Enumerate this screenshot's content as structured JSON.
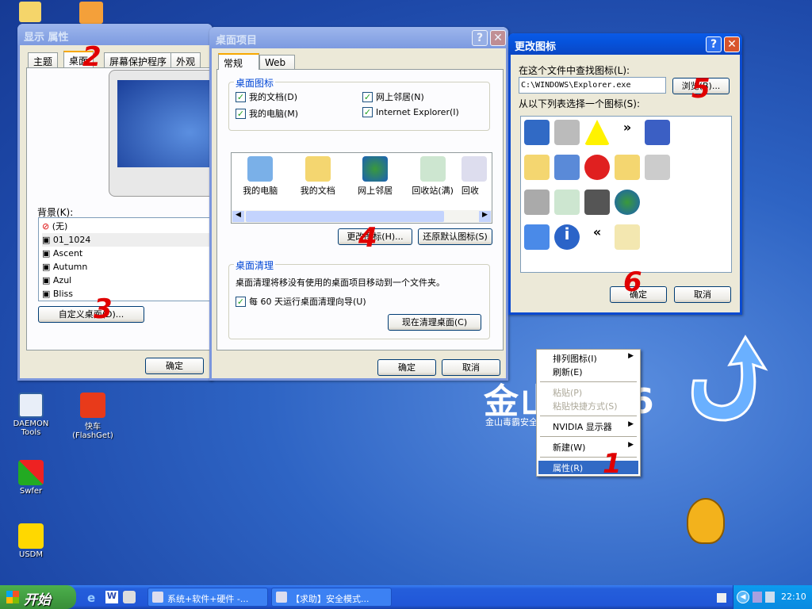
{
  "desktop": {
    "icons": [
      {
        "label": "DAEMON Tools"
      },
      {
        "label": "快车\n(FlashGet)"
      },
      {
        "label": "Swfer"
      },
      {
        "label": "USDM"
      }
    ],
    "logo_text": "金山毒霸6",
    "logo_sub": "金山毒霸安全 .net"
  },
  "display_props": {
    "title": "显示 属性",
    "tabs": [
      "主题",
      "桌面",
      "屏幕保护程序",
      "外观"
    ],
    "selected_tab": "桌面",
    "background_label": "背景(K):",
    "backgrounds": [
      "(无)",
      "01_1024",
      "Ascent",
      "Autumn",
      "Azul",
      "Bliss"
    ],
    "selected_background": "01_1024",
    "customize_button": "自定义桌面(D)...",
    "ok": "确定"
  },
  "desktop_items": {
    "title": "桌面项目",
    "help": "?",
    "close": "✕",
    "tabs": [
      "常规",
      "Web"
    ],
    "group_icons": "桌面图标",
    "checkboxes": [
      {
        "label": "我的文档(D)",
        "checked": true
      },
      {
        "label": "网上邻居(N)",
        "checked": true
      },
      {
        "label": "我的电脑(M)",
        "checked": true
      },
      {
        "label": "Internet Explorer(I)",
        "checked": true
      }
    ],
    "icon_list": [
      "我的电脑",
      "我的文档",
      "网上邻居",
      "回收站(满)",
      "回收"
    ],
    "change_icon": "更改图标(H)...",
    "restore_default": "还原默认图标(S)",
    "group_cleanup": "桌面清理",
    "cleanup_text": "桌面清理将移没有使用的桌面项目移动到一个文件夹。",
    "cleanup_checkbox": {
      "label": "每 60 天运行桌面清理向导(U)",
      "checked": true
    },
    "cleanup_now": "现在清理桌面(C)",
    "ok": "确定",
    "cancel": "取消"
  },
  "change_icon": {
    "title": "更改图标",
    "help": "?",
    "close": "✕",
    "find_label": "在这个文件中查找图标(L):",
    "file_value": "C:\\WINDOWS\\Explorer.exe",
    "browse": "浏览(B)...",
    "select_label": "从以下列表选择一个图标(S):",
    "ok": "确定",
    "cancel": "取消"
  },
  "context_menu": {
    "items": [
      {
        "label": "排列图标(I)",
        "submenu": true
      },
      {
        "label": "刷新(E)"
      },
      {
        "sep": true
      },
      {
        "label": "粘贴(P)",
        "disabled": true
      },
      {
        "label": "粘贴快捷方式(S)",
        "disabled": true
      },
      {
        "sep": true
      },
      {
        "label": "NVIDIA 显示器",
        "submenu": true
      },
      {
        "sep": true
      },
      {
        "label": "新建(W)",
        "submenu": true
      },
      {
        "sep": true
      },
      {
        "label": "属性(R)",
        "highlighted": true
      }
    ]
  },
  "annotations": [
    "1",
    "2",
    "3",
    "4",
    "5",
    "6"
  ],
  "taskbar": {
    "start": "开始",
    "tasks": [
      "系统+软件+硬件 -...",
      "【求助】安全模式..."
    ],
    "clock": "22:10"
  },
  "colors": {
    "accent": "#0a4ad0",
    "annotation": "#e00000",
    "menu_highlight": "#316ac5"
  }
}
